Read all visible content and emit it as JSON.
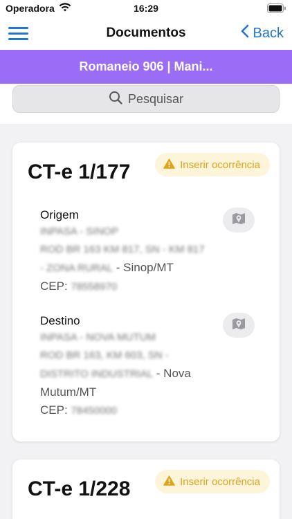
{
  "status_bar": {
    "carrier": "Operadora",
    "time": "16:29"
  },
  "nav": {
    "title": "Documentos",
    "back_label": "Back"
  },
  "banner": {
    "title": "Romaneio 906 | Mani..."
  },
  "search": {
    "placeholder": "Pesquisar"
  },
  "documents": [
    {
      "title": "CT-e 1/177",
      "occurrence_label": "Inserir ocorrência",
      "origin": {
        "label": "Origem",
        "name": "INPASA - SINOP",
        "street": "ROD BR 163 KM 817, SN - KM 817",
        "district": "- ZONA RURAL",
        "city": " - Sinop/MT",
        "cep_label": "CEP: ",
        "cep": "78558970"
      },
      "destination": {
        "label": "Destino",
        "name": "INPASA - NOVA MUTUM",
        "street": "ROD BR 163, KM 603, SN -",
        "district": "DISTRITO INDUSTRIAL",
        "city": " - Nova",
        "city2": "Mutum/MT",
        "cep_label": "CEP: ",
        "cep": "78450000"
      }
    },
    {
      "title": "CT-e 1/228",
      "occurrence_label": "Inserir ocorrência"
    }
  ],
  "colors": {
    "accent_blue": "#1f74d6",
    "banner_purple": "#9b6cf5",
    "warning_yellow": "#e0a21b"
  }
}
